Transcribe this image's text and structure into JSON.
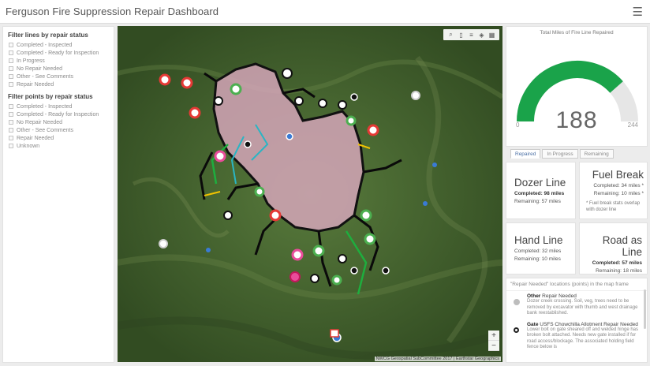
{
  "header": {
    "title": "Ferguson Fire Suppression Repair Dashboard",
    "menu_icon": "hamburger-icon"
  },
  "left_panel": {
    "line_filter": {
      "title": "Filter lines by repair status",
      "options": [
        "Completed - Inspected",
        "Completed - Ready for Inspection",
        "In Progress",
        "No Repair Needed",
        "Other - See Comments",
        "Repair Needed"
      ]
    },
    "point_filter": {
      "title": "Filter points by repair status",
      "options": [
        "Completed - Inspected",
        "Completed - Ready for Inspection",
        "No Repair Needed",
        "Other - See Comments",
        "Repair Needed",
        "Unknown"
      ]
    }
  },
  "map": {
    "tools": [
      "search-icon",
      "bookmark-icon",
      "list-icon",
      "layers-icon",
      "basemap-icon"
    ],
    "zoom_in": "+",
    "zoom_out": "−",
    "attribution": "NWCG Geospatial SubCommittee 2017 | Earthstar Geographics"
  },
  "gauge": {
    "title": "Total Miles of Fire Line Repaired",
    "value": 188,
    "value_text": "188",
    "min": 0,
    "min_text": "0",
    "max": 244,
    "max_text": "244",
    "fill_color": "#1aa34a",
    "track_color": "#e6e6e6"
  },
  "tabs": [
    {
      "label": "Repaired",
      "active": true
    },
    {
      "label": "In Progress",
      "active": false
    },
    {
      "label": "Remaining",
      "active": false
    }
  ],
  "cards": {
    "dozer": {
      "title": "Dozer Line",
      "completed": "Completed: 98 miles",
      "remaining": "Remaining: 57 miles"
    },
    "fuel": {
      "title": "Fuel Break",
      "completed": "Completed: 34 miles *",
      "remaining": "Remaining: 10 miles *",
      "note": "* Fuel break stats overlap with dozer line"
    },
    "hand": {
      "title": "Hand Line",
      "completed": "Completed: 32 miles",
      "remaining": "Remaining: 10 miles"
    },
    "road": {
      "title": "Road as Line",
      "completed": "Completed: 57 miles",
      "remaining": "Remaining: 18 miles"
    }
  },
  "list": {
    "heading": "\"Repair Needed\" locations (points) in the map frame",
    "items": [
      {
        "type": "Other",
        "status": "Repair Needed",
        "description": "Dozer creek crossing. Soil, veg, trees need to be removed by excavator with thumb and west drainage bank reestablished.",
        "dot_color": "#bdbdbd"
      },
      {
        "type": "Gate",
        "status": "USFS Chowchilla Allotment Repair Needed",
        "description": "Lower bolt on gate sheared off and welded hinge has broken bolt attached. Needs new gate installed if for road access/blockage. The associated holding field fence below is",
        "dot_color": "#222222"
      }
    ]
  }
}
